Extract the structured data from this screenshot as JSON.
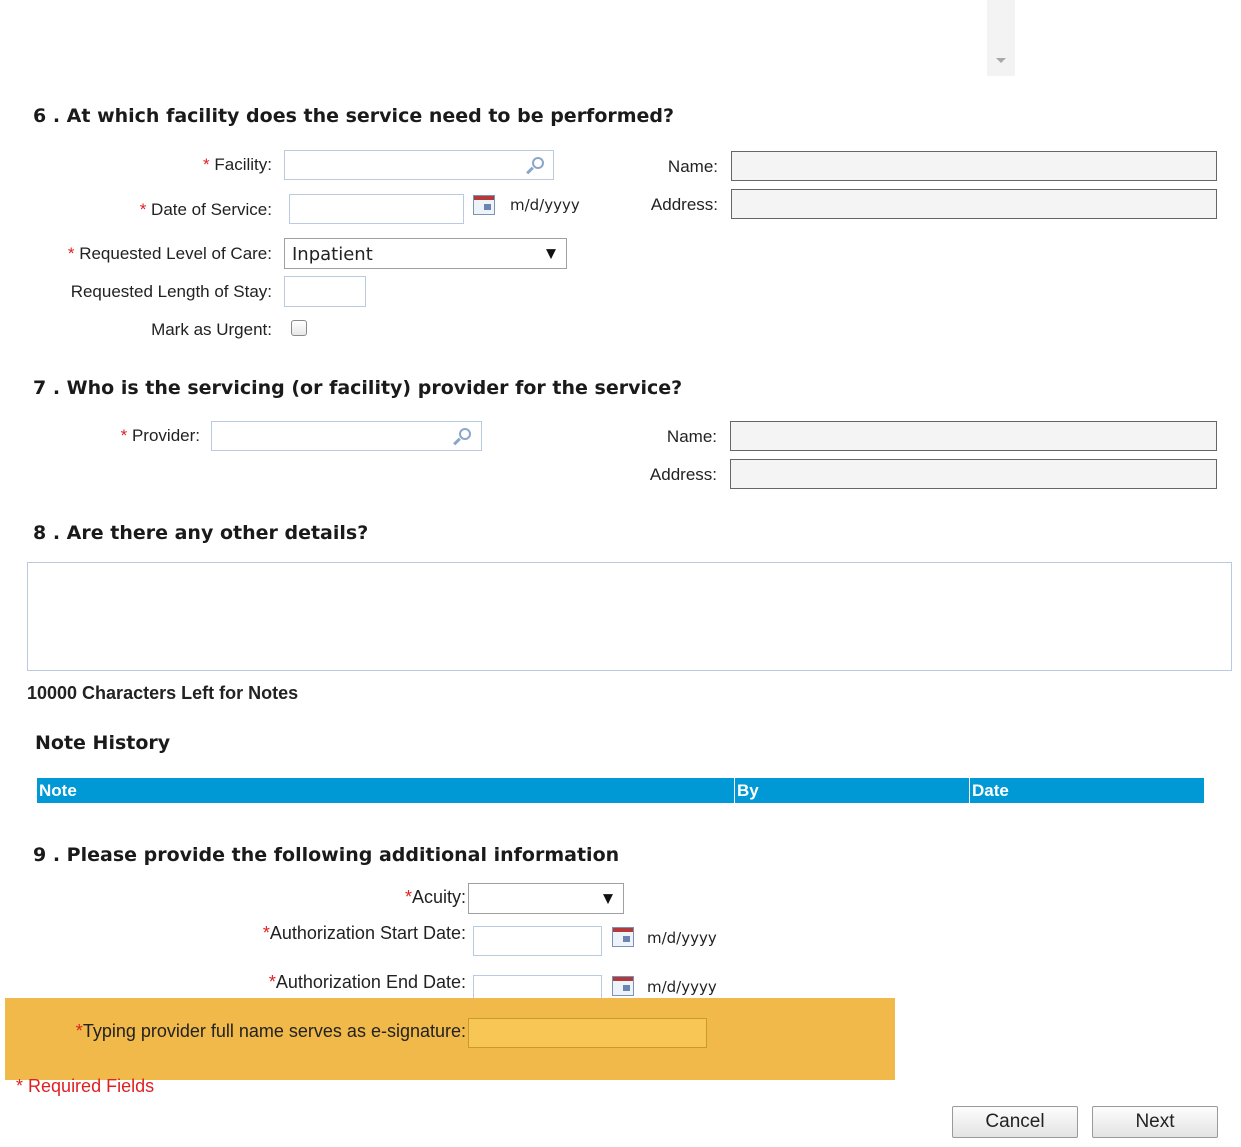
{
  "section6": {
    "heading": "6 . At which facility does the service need to be performed?",
    "facility_label": "Facility:",
    "date_of_service_label": "Date of Service:",
    "date_format": "m/d/yyyy",
    "level_of_care_label": "Requested Level of Care:",
    "level_of_care_value": "Inpatient",
    "length_of_stay_label": "Requested Length of Stay:",
    "urgent_label": "Mark as Urgent:",
    "name_label": "Name:",
    "address_label": "Address:"
  },
  "section7": {
    "heading": "7 . Who is the servicing (or facility) provider for the service?",
    "provider_label": "Provider:",
    "name_label": "Name:",
    "address_label": "Address:"
  },
  "section8": {
    "heading": "8 . Are there any other details?",
    "chars_left": "10000 Characters Left for Notes",
    "note_history_title": "Note History",
    "columns": [
      "Note",
      "By",
      "Date"
    ]
  },
  "section9": {
    "heading": "9 . Please provide the following additional information",
    "acuity_label": "Acuity:",
    "auth_start_label": "Authorization Start Date:",
    "auth_end_label": "Authorization End Date:",
    "date_format": "m/d/yyyy",
    "signature_label": "Typing provider full name serves as e-signature:"
  },
  "required_marker": "*",
  "required_fields_text": "Required Fields",
  "buttons": {
    "cancel": "Cancel",
    "next": "Next"
  },
  "colors": {
    "table_header": "#0099d6",
    "highlight": "#f0b94a",
    "required": "#e02020"
  }
}
